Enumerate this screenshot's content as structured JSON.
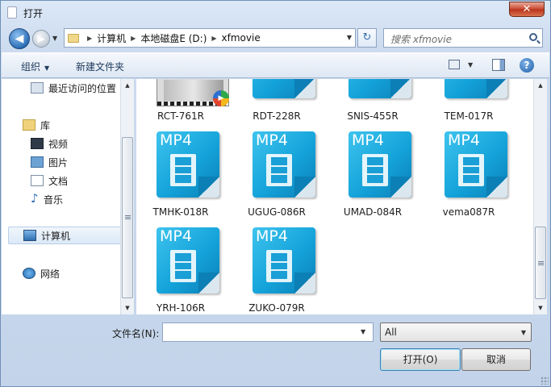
{
  "window": {
    "title": "打开",
    "close_glyph": "✕"
  },
  "nav": {
    "back_glyph": "◀",
    "forward_glyph": "▶",
    "breadcrumb": [
      "计算机",
      "本地磁盘E (D:)",
      "xfmovie"
    ],
    "refresh_glyph": "↻"
  },
  "search": {
    "placeholder": "搜索 xfmovie"
  },
  "toolbar": {
    "organize_label": "组织",
    "new_folder_label": "新建文件夹",
    "help_glyph": "?"
  },
  "sidebar": {
    "items": [
      {
        "label": "最近访问的位置",
        "icon": "recent-places-icon"
      },
      {
        "label": "库",
        "icon": "library-icon"
      },
      {
        "label": "视频",
        "icon": "video-library-icon"
      },
      {
        "label": "图片",
        "icon": "pictures-library-icon"
      },
      {
        "label": "文档",
        "icon": "documents-library-icon"
      },
      {
        "label": "音乐",
        "icon": "music-library-icon"
      },
      {
        "label": "计算机",
        "icon": "computer-icon",
        "selected": true
      },
      {
        "label": "网络",
        "icon": "network-icon"
      }
    ]
  },
  "files": {
    "icon_text": "MP4",
    "items": [
      {
        "name": "RCT-761R",
        "thumb": "video-thumbnail"
      },
      {
        "name": "RDT-228R",
        "thumb": "mp4-file-icon"
      },
      {
        "name": "SNIS-455R",
        "thumb": "mp4-file-icon"
      },
      {
        "name": "TEM-017R",
        "thumb": "mp4-file-icon"
      },
      {
        "name": "TMHK-018R",
        "thumb": "mp4-file-icon"
      },
      {
        "name": "UGUG-086R",
        "thumb": "mp4-file-icon"
      },
      {
        "name": "UMAD-084R",
        "thumb": "mp4-file-icon"
      },
      {
        "name": "vema087R",
        "thumb": "mp4-file-icon"
      },
      {
        "name": "YRH-106R",
        "thumb": "mp4-file-icon"
      },
      {
        "name": "ZUKO-079R",
        "thumb": "mp4-file-icon"
      }
    ]
  },
  "footer": {
    "filename_label": "文件名(N):",
    "filename_value": "",
    "filter_value": "All",
    "open_label": "打开(O)",
    "cancel_label": "取消"
  },
  "colors": {
    "accent": "#14a3da",
    "window_frame": "#c3d4ea"
  }
}
